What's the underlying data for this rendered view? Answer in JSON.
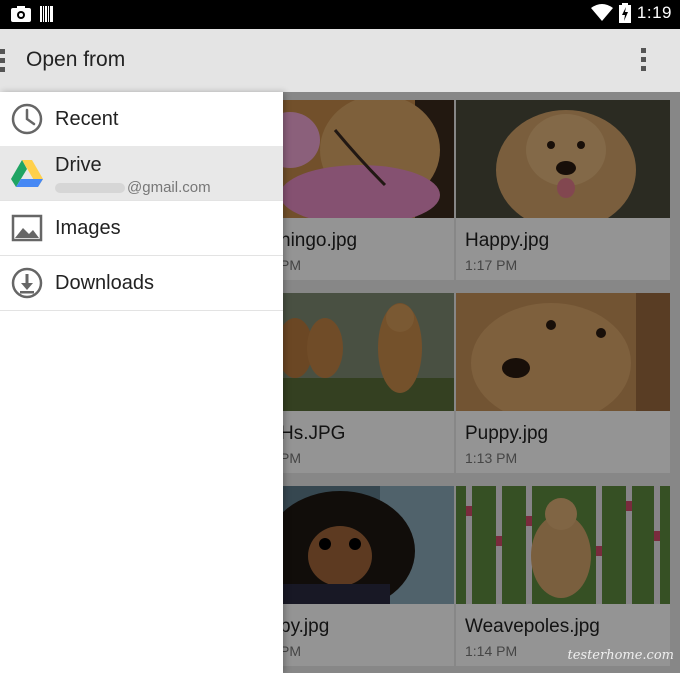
{
  "status_bar": {
    "time": "1:19"
  },
  "action_bar": {
    "title": "Open from"
  },
  "drawer": {
    "items": [
      {
        "label": "Recent"
      },
      {
        "label": "Drive",
        "account_suffix": "@gmail.com"
      },
      {
        "label": "Images"
      },
      {
        "label": "Downloads"
      }
    ]
  },
  "files": [
    {
      "name": "Flamingo.jpg",
      "visible_name": "hingo.jpg",
      "visible_time": "PM"
    },
    {
      "name": "Happy.jpg",
      "time": "1:17 PM"
    },
    {
      "name": "GHs.JPG",
      "visible_name": "Hs.JPG",
      "visible_time": "PM"
    },
    {
      "name": "Puppy.jpg",
      "time": "1:13 PM"
    },
    {
      "name": "by.jpg",
      "visible_name": "by.jpg",
      "visible_time": "PM"
    },
    {
      "name": "Weavepoles.jpg",
      "time": "1:14 PM"
    }
  ],
  "watermark": "testerhome.com",
  "colors": {
    "drive_green": "#1fa463",
    "drive_yellow": "#ffd04b",
    "drive_blue": "#4688f4"
  }
}
